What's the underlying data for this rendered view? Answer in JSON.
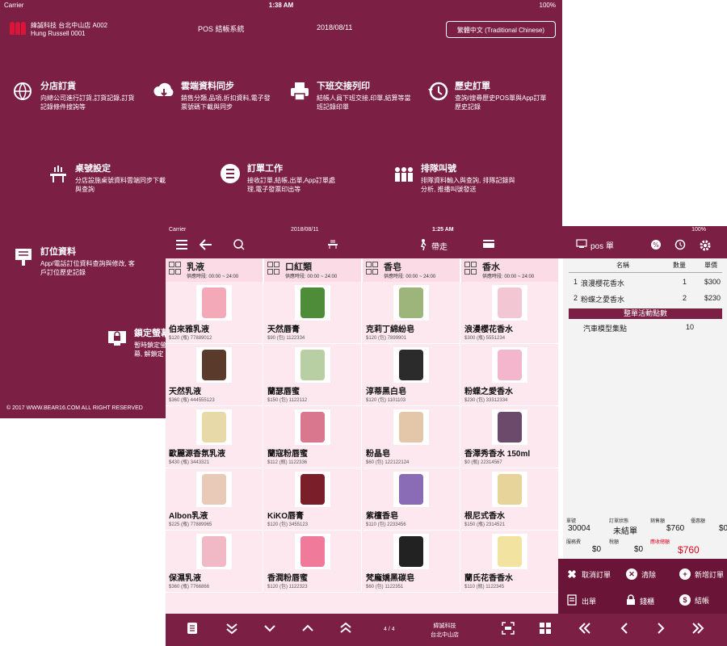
{
  "background_screen": {
    "status": {
      "carrier": "Carrier",
      "time": "1:38 AM",
      "battery": "100%"
    },
    "store_name": "緯誠科技 台北中山店 A002",
    "user_name": "Hung Russell 0001",
    "system_title": "POS 結帳系統",
    "date": "2018/08/11",
    "language_button": "繁體中文 (Traditional Chinese)",
    "menu": [
      {
        "title": "分店訂貨",
        "desc": "向總公司進行訂貨,訂貨記錄,訂貨記錄條件搜詢等",
        "icon": "globe-cart-icon"
      },
      {
        "title": "雲端資料同步",
        "desc": "銷售分類,品項,折扣資料,電子發票號碼下載與同步",
        "icon": "cloud-sync-icon"
      },
      {
        "title": "下班交接列印",
        "desc": "結帳人員下班交接,印單,結算等當班記錄印單",
        "icon": "printer-icon"
      },
      {
        "title": "歷史訂單",
        "desc": "查詢/搜尋歷史POS單與App訂單歷史記錄",
        "icon": "history-icon"
      },
      {
        "title": "桌號設定",
        "desc": "分店設施桌號資料雲端同步下載與查詢",
        "icon": "table-icon"
      },
      {
        "title": "訂單工作",
        "desc": "接收訂單,結帳,出單,App訂單處理,電子發票印出等",
        "icon": "list-icon"
      },
      {
        "title": "排隊叫號",
        "desc": "排隊資料輸入與查詢, 排隊記錄與分析, 推播叫號發送",
        "icon": "queue-icon"
      },
      {
        "title": "訂位資料",
        "desc": "App/電話訂位資料查詢與修改, 客戶訂位歷史記錄",
        "icon": "reservation-icon"
      },
      {
        "title": "鎖定螢幕",
        "desc": "暫時鎖定螢幕, 解鎖定",
        "icon": "lock-screen-icon"
      }
    ],
    "copyright": "© 2017 WWW.BEAR16.COM ALL RIGHT RESERVED"
  },
  "pos_screen": {
    "status": {
      "carrier": "Carrier",
      "date": "2018/08/11",
      "time": "1:25 AM",
      "battery": "100%"
    },
    "toolbar": {
      "takeout_label": "帶走",
      "pos_order_label": "pos 單"
    },
    "categories": [
      {
        "name": "乳液",
        "hours": "供應時段: 00:00 ~ 24:00"
      },
      {
        "name": "口紅類",
        "hours": "供應時段: 00:00 ~ 24:00"
      },
      {
        "name": "香皂",
        "hours": "供應時段: 00:00 ~ 24:00"
      },
      {
        "name": "香水",
        "hours": "供應時段: 00:00 ~ 24:00"
      }
    ],
    "products": [
      [
        {
          "name": "伯來雅乳液",
          "info": "$120 (瓶)  77889012",
          "color": "#f4a9b9"
        },
        {
          "name": "天然唇膏",
          "info": "$90 (包)  1122334",
          "color": "#4f8c3a"
        },
        {
          "name": "克莉丁綿紛皂",
          "info": "$120 (包)  7899901",
          "color": "#9db57a"
        },
        {
          "name": "浪漫櫻花香水",
          "info": "$300 (瓶)  5551234",
          "color": "#f2c7d3"
        }
      ],
      [
        {
          "name": "天然乳液",
          "info": "$360 (瓶)  444555123",
          "color": "#5a3a2a"
        },
        {
          "name": "蘭瑟唇蜜",
          "info": "$150 (包)  1122112",
          "color": "#b7cfa3"
        },
        {
          "name": "淳蒂黑白皂",
          "info": "$120 (包)  1101103",
          "color": "#2b2b2b"
        },
        {
          "name": "粉蝶之愛香水",
          "info": "$230 (包)  33312334",
          "color": "#f3b6cc"
        }
      ],
      [
        {
          "name": "歐麗源香氛乳液",
          "info": "$430 (瓶)  3443321",
          "color": "#e8d9a9"
        },
        {
          "name": "蘭寇粉唇蜜",
          "info": "$112 (瓶)  1122336",
          "color": "#d9778f"
        },
        {
          "name": "粉晶皂",
          "info": "$60 (包)  122122124",
          "color": "#e3c7a8"
        },
        {
          "name": "香澤秀香水 150ml",
          "info": "$0 (瓶)  22314567",
          "color": "#6b4a6b"
        }
      ],
      [
        {
          "name": "Albon乳液",
          "info": "$225 (瓶)  77889965",
          "color": "#e9c9b8"
        },
        {
          "name": "KiKO唇膏",
          "info": "$120 (包)  3455123",
          "color": "#7a1f2a"
        },
        {
          "name": "紫檀香皂",
          "info": "$110 (包)  2233456",
          "color": "#8a6bb5"
        },
        {
          "name": "根尼式香水",
          "info": "$150 (瓶)  2314521",
          "color": "#e6d49a"
        }
      ],
      [
        {
          "name": "保濕乳液",
          "info": "$360 (瓶)  7766866",
          "color": "#f1b9c6"
        },
        {
          "name": "香潤粉唇蜜",
          "info": "$120 (包)  1122323",
          "color": "#f07a9a"
        },
        {
          "name": "梵龐嬌黑碳皂",
          "info": "$60 (包)  1122351",
          "color": "#222222"
        },
        {
          "name": "蘭氏花香香水",
          "info": "$110 (瓶)  1122345",
          "color": "#f3e3a1"
        }
      ]
    ],
    "order": {
      "col_name": "名稱",
      "col_qty": "數量",
      "col_price": "單價",
      "items": [
        {
          "index": "1",
          "name": "浪漫櫻花香水",
          "qty": "1",
          "price": "$300"
        },
        {
          "index": "2",
          "name": "粉蝶之愛香水",
          "qty": "2",
          "price": "$230"
        }
      ],
      "promo_label": "整單活動點數",
      "points_item": {
        "name": "汽車模型集點",
        "qty": "10"
      }
    },
    "totals": {
      "order_no_label": "單號",
      "order_no": "30004",
      "status_label": "訂單狀態",
      "status": "未結單",
      "sales_label": "銷售額",
      "sales": "$760",
      "discount_label": "優惠額",
      "discount": "$0",
      "service_label": "服務費",
      "service": "$0",
      "tax_label": "稅額",
      "tax": "$0",
      "receivable_label": "應收總額",
      "receivable": "$760"
    },
    "actions": [
      {
        "label": "取消訂單",
        "icon": "cancel-icon"
      },
      {
        "label": "清除",
        "icon": "clear-icon"
      },
      {
        "label": "新增訂單",
        "icon": "add-icon"
      },
      {
        "label": "出單",
        "icon": "print-receipt-icon"
      },
      {
        "label": "錢櫃",
        "icon": "cash-drawer-icon"
      },
      {
        "label": "結帳",
        "icon": "checkout-icon"
      }
    ],
    "bottom": {
      "page": "4 / 4",
      "shop_line1": "緯誠科技",
      "shop_line2": "台北中山店"
    },
    "colors": {
      "brand": "#7b1f45",
      "grid_bg": "#fde8ef",
      "header_bg": "#fbdbe5",
      "receivable": "#e0001b"
    }
  }
}
